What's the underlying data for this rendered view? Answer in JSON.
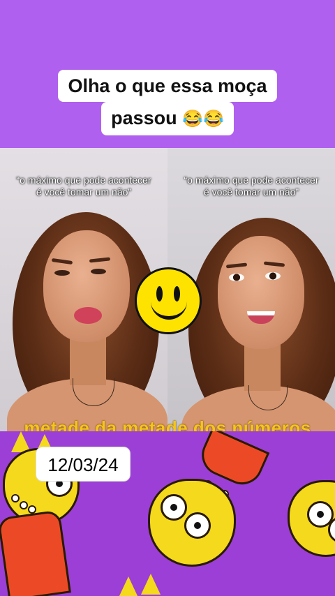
{
  "headline": {
    "line1": "Olha o que essa moça",
    "line2": "passou",
    "emoji": "😂😂"
  },
  "video": {
    "left_caption": "“o máximo que pode acontecer é você tomar um não”",
    "right_caption": "“o máximo que pode acontecer é você tomar um não”",
    "ticker": "metade da metade dos números"
  },
  "sticker": "smiley-face",
  "date_badge": "12/03/24",
  "colors": {
    "background": "#a34fd8",
    "ticker": "#f6c51a",
    "smiley": "#ffe300"
  }
}
